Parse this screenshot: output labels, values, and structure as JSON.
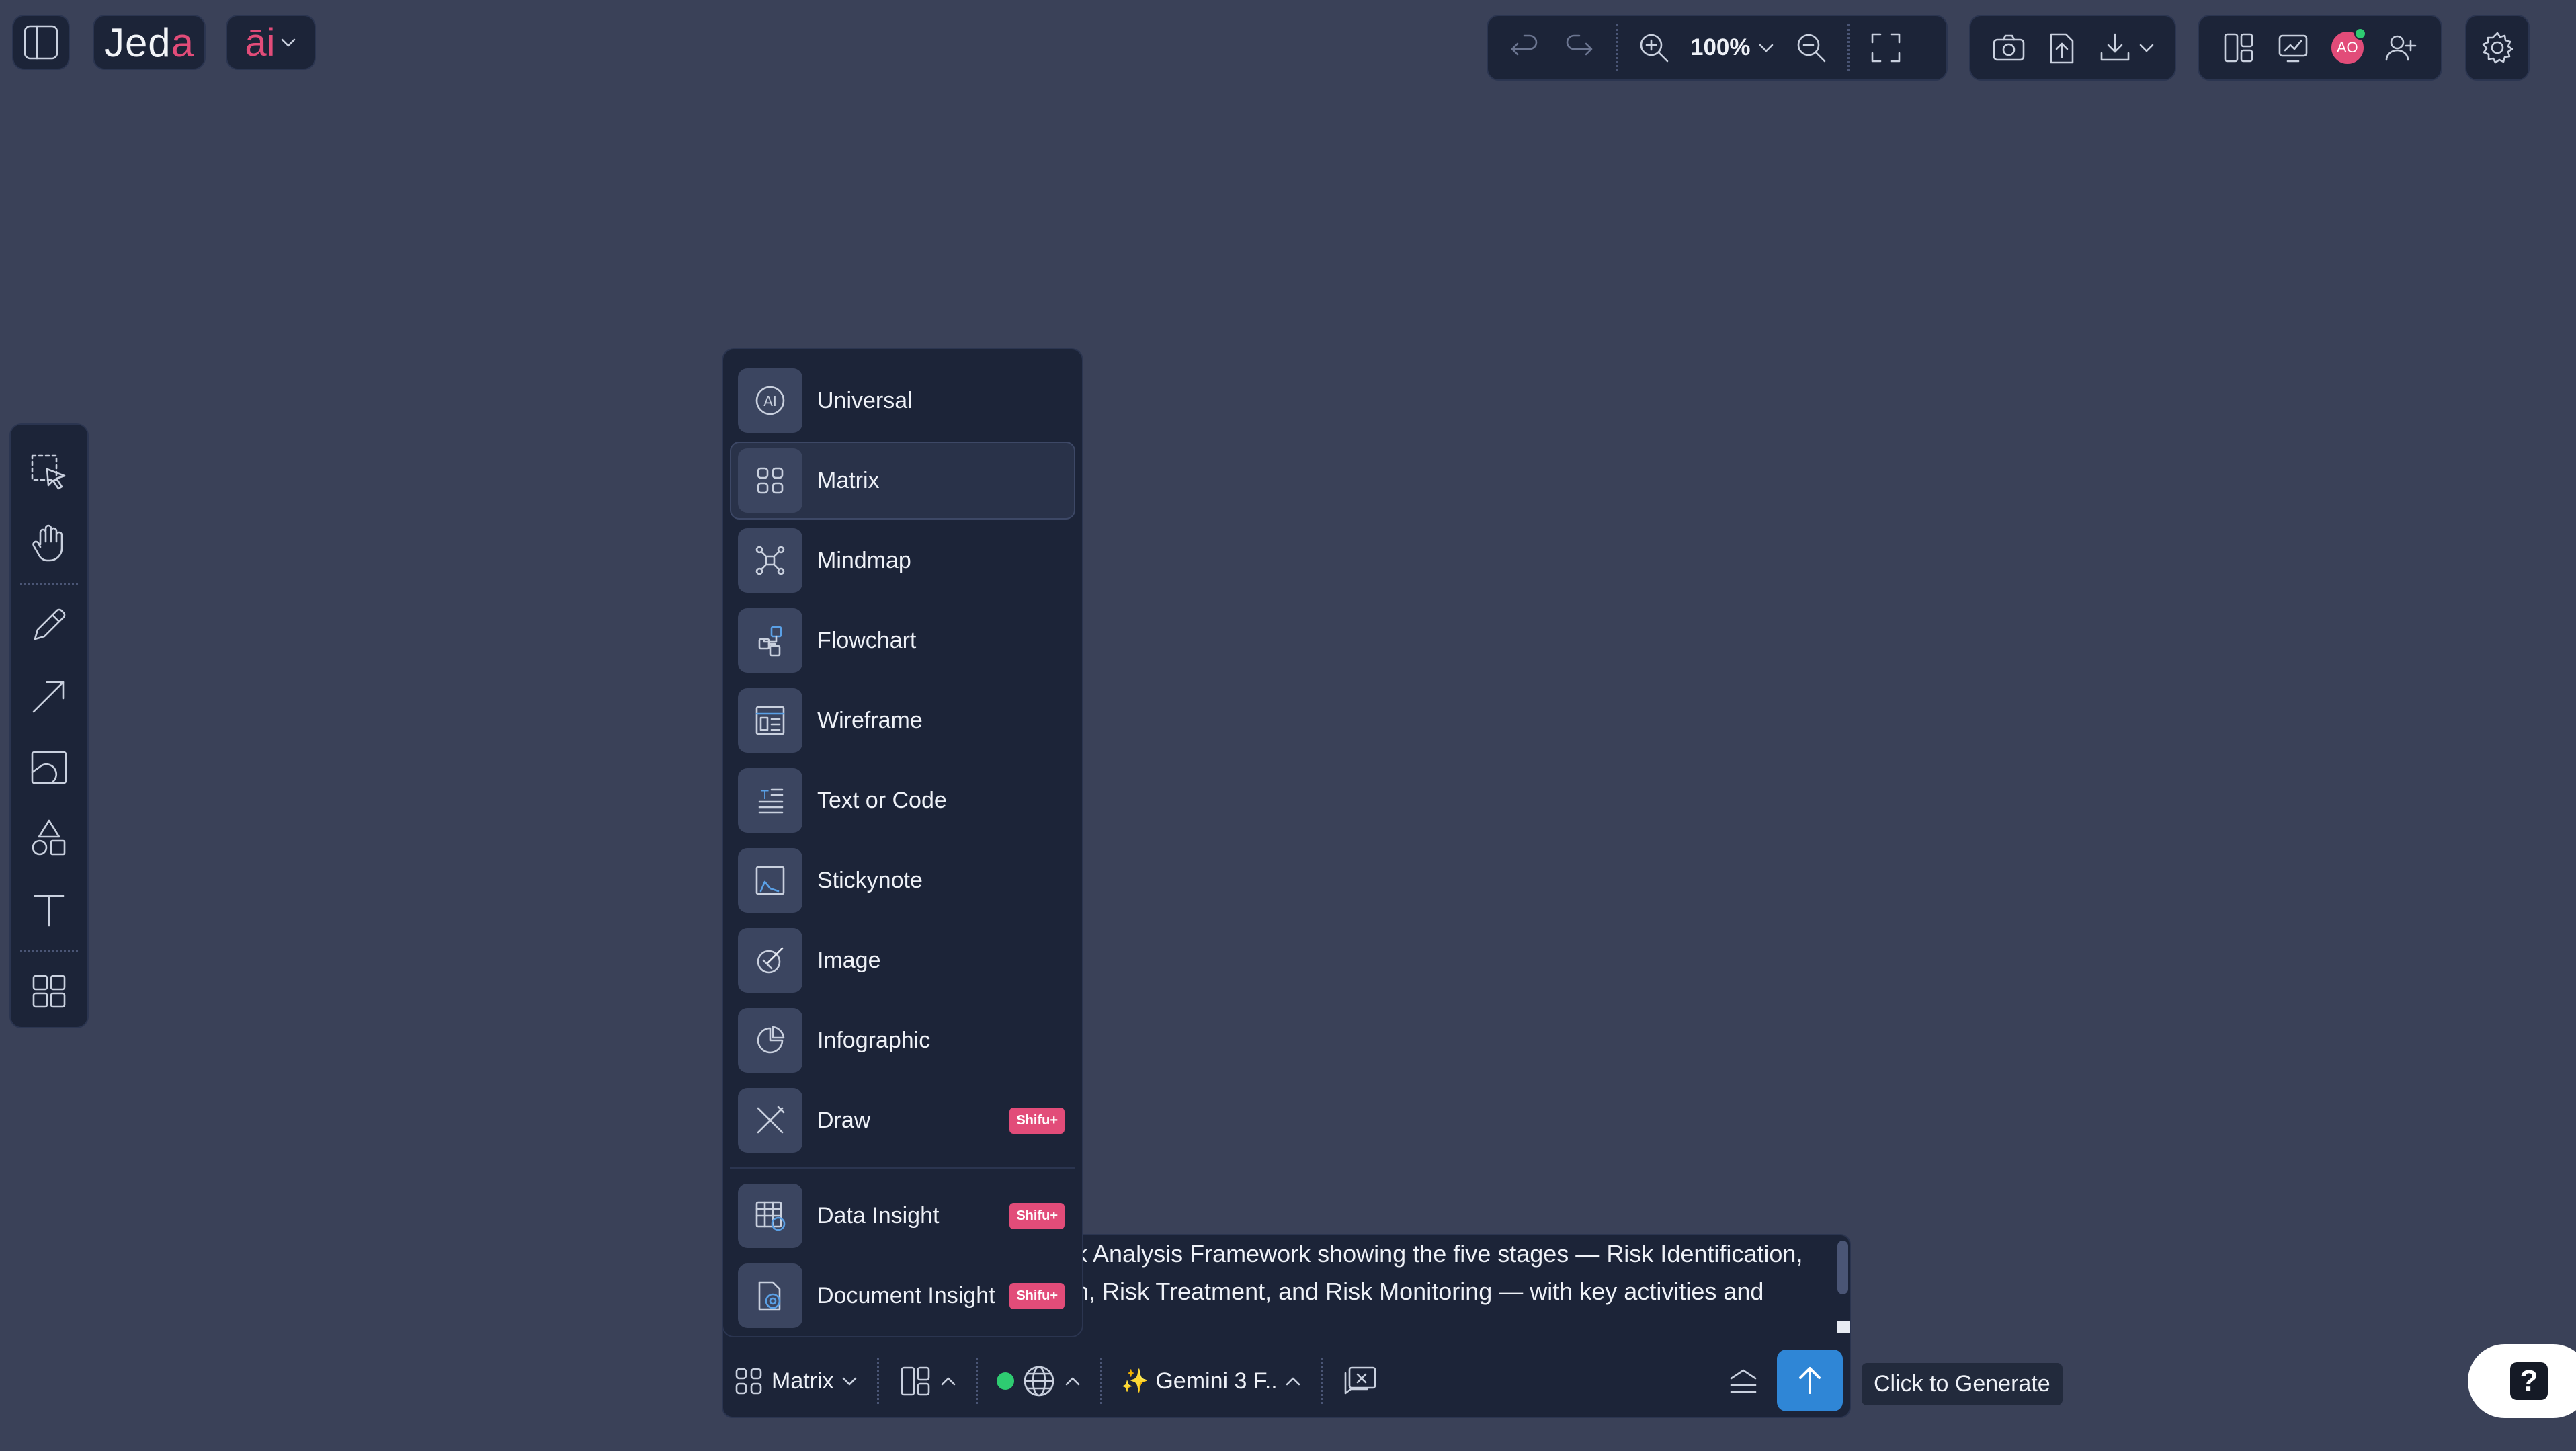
{
  "app": {
    "logo_main": "Jed",
    "logo_accent": "a",
    "ai_label": "āi"
  },
  "toolbar": {
    "zoom_level": "100%"
  },
  "collab": {
    "avatar_initials": "AO"
  },
  "mode_menu": {
    "items": [
      {
        "label": "Universal"
      },
      {
        "label": "Matrix"
      },
      {
        "label": "Mindmap"
      },
      {
        "label": "Flowchart"
      },
      {
        "label": "Wireframe"
      },
      {
        "label": "Text or Code"
      },
      {
        "label": "Stickynote"
      },
      {
        "label": "Image"
      },
      {
        "label": "Infographic"
      },
      {
        "label": "Draw",
        "badge": "Shifu+"
      },
      {
        "label": "Data Insight",
        "badge": "Shifu+"
      },
      {
        "label": "Document Insight",
        "badge": "Shifu+"
      }
    ],
    "selected": "Matrix"
  },
  "composer": {
    "prompt_line1": "k Analysis Framework showing the five stages — Risk Identification,",
    "prompt_line2": "n, Risk Treatment, and Risk Monitoring — with key activities and",
    "mode_label": "Matrix",
    "model_label": "✨ Gemini 3 F..",
    "generate_tooltip": "Click to Generate"
  },
  "help": {
    "label": "?"
  }
}
